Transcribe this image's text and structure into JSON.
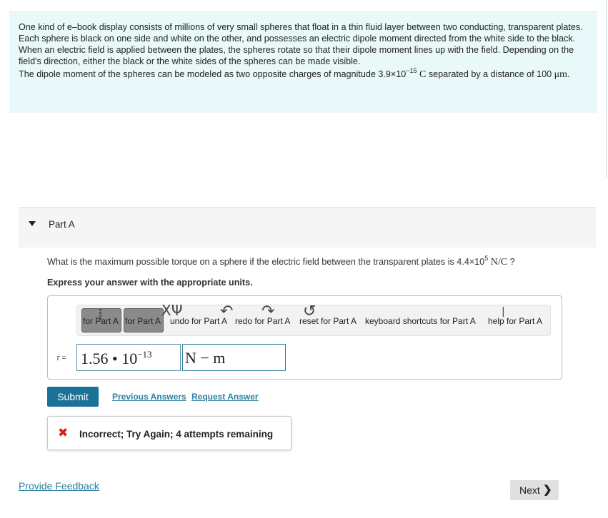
{
  "intro": {
    "paragraph1": "One kind of e–book display consists of millions of very small spheres that float in a thin fluid layer between two conducting, transparent plates. Each sphere is black on one side and white on the other, and possesses an electric dipole moment directed from the white side to the black. When an electric field is applied between the plates, the spheres rotate so that their dipole moment lines up with the field. Depending on the field's direction, either the black or the white sides of the spheres can be made visible.",
    "p2_before": "The dipole moment of the spheres can be modeled as two opposite charges of magnitude 3.9×10",
    "p2_exp": "−15",
    "p2_unit": "C",
    "p2_mid": " separated by a distance of",
    "p2_dist": "100",
    "p2_dist_unit": "μm",
    "p2_end": "."
  },
  "part": {
    "title": "Part A",
    "question_before": "What is the maximum possible torque on a sphere if the electric field between the transparent plates is 4.4×10",
    "question_exp": "5",
    "question_unit": "N/C",
    "question_end": "?",
    "instruction": "Express your answer with the appropriate units."
  },
  "toolbar": {
    "btn1_label": "for Part A",
    "btn2_label": "for Part A",
    "undo": "undo for Part A",
    "redo": "redo for Part A",
    "reset": "reset for Part A",
    "shortcuts": "keyboard shortcuts for Part A",
    "help": "help for Part A"
  },
  "answer": {
    "symbol": "τ",
    "equals": "=",
    "value_mantissa": "1.56 • 10",
    "value_exponent": "−13",
    "unit_value": "N − m"
  },
  "actions": {
    "submit": "Submit",
    "previous_answers": "Previous Answers",
    "request_answer": "Request Answer"
  },
  "feedback": {
    "icon": "✖",
    "text": "Incorrect; Try Again; 4 attempts remaining"
  },
  "footer": {
    "provide_feedback": "Provide Feedback",
    "next": "Next",
    "next_chevron": "❯"
  },
  "colors": {
    "accent": "#1a7296",
    "link": "#2a7fa0",
    "error": "#d6201b",
    "intro_bg": "#e9f8f8"
  }
}
